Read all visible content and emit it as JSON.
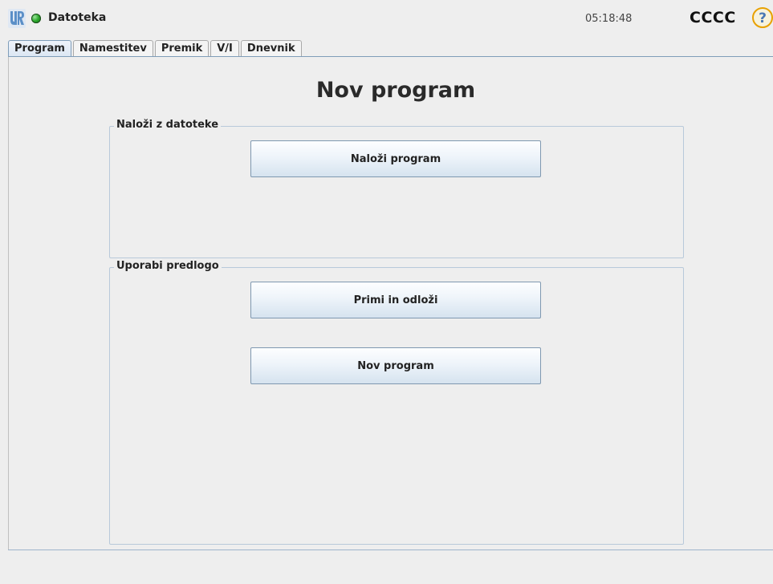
{
  "header": {
    "app_title": "Datoteka",
    "clock": "05:18:48",
    "robot_name": "CCCC",
    "status_color": "#2eaa2e"
  },
  "tabs": [
    {
      "label": "Program",
      "active": true
    },
    {
      "label": "Namestitev",
      "active": false
    },
    {
      "label": "Premik",
      "active": false
    },
    {
      "label": "V/I",
      "active": false
    },
    {
      "label": "Dnevnik",
      "active": false
    }
  ],
  "main": {
    "title": "Nov program",
    "load_group": {
      "legend": "Naloži z datoteke",
      "load_button": "Naloži program"
    },
    "template_group": {
      "legend": "Uporabi predlogo",
      "pick_place_button": "Primi in odloži",
      "new_program_button": "Nov program"
    }
  },
  "icons": {
    "logo": "ur-logo-icon",
    "status": "status-led-icon",
    "help": "help-icon"
  },
  "colors": {
    "accent": "#7f9db9",
    "help": "#e8a100"
  }
}
